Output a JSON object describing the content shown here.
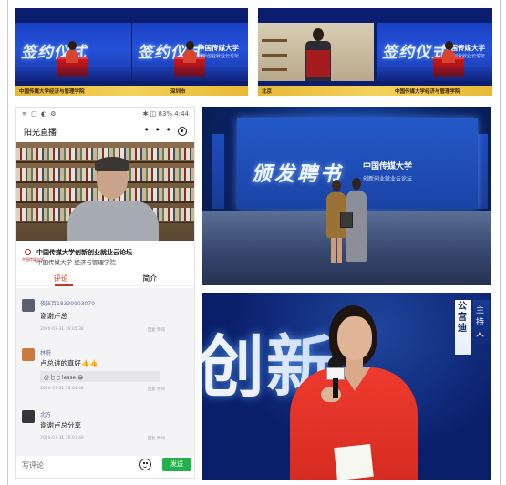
{
  "signing": {
    "left": {
      "title": "签约仪式",
      "university": "中国传媒大学",
      "subtitle": "创新创业就业云论坛",
      "left_caption": "中国传媒大学经济与管理学院",
      "right_caption": "深圳市"
    },
    "right": {
      "title": "签约仪式",
      "university": "中国传媒大学",
      "subtitle": "创新创业就业云论坛",
      "left_caption": "北京",
      "right_caption": "中国传媒大学经济与管理学院"
    }
  },
  "phone": {
    "status": {
      "left": "≋ ▢ ◐ ⚙",
      "right": "✱ ◫ 83% 4:44"
    },
    "app_title": "阳光直播",
    "menu_dots": "• • •",
    "talk_title": "中国传媒大学创新创业就业云论坛",
    "talk_subtitle": "中国传媒大学-经济与管理学院",
    "logo_text": "中国传媒大学",
    "tabs": [
      "评论",
      "简介"
    ],
    "comments": [
      {
        "user": "夜伍百18339903070",
        "text": "谢谢卢总",
        "meta": "2020-07-31 16:05:38",
        "actions": "回复 赞同",
        "avatar_color": "#5a5f6e"
      },
      {
        "user": "林蔚",
        "text": "卢总讲的真好👍👍",
        "quote": "@七七 lesse  😀",
        "meta": "2020-07-31 16:04:48",
        "actions": "回复 赞同",
        "avatar_color": "#c87b3c"
      },
      {
        "user": "北方",
        "text": "谢谢卢总分享",
        "meta": "2020-07-31 16:03:49",
        "actions": "回复 赞同",
        "avatar_color": "#343638"
      }
    ],
    "input_placeholder": "写评论",
    "send_label": "发送"
  },
  "stage": {
    "title": "颁发聘书",
    "university": "中国传媒大学",
    "subtitle": "创新创业就业云论坛"
  },
  "host": {
    "bg_text": "创新",
    "name": "公宫迪",
    "role": "主持人"
  },
  "colors": {
    "brand_red": "#c9361f",
    "send_green": "#23b24a",
    "stage_blue": "#1b43a6"
  }
}
